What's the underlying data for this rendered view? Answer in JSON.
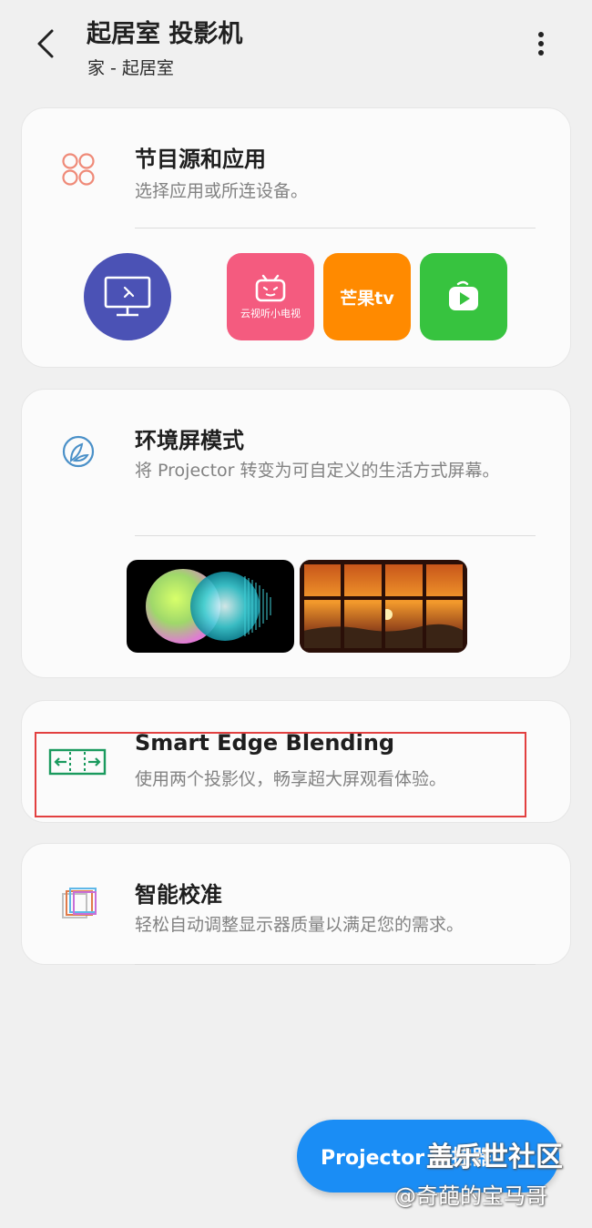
{
  "header": {
    "title": "起居室 投影机",
    "subtitle": "家 - 起居室",
    "back_icon": "chevron-left-icon",
    "more_icon": "more-vertical-icon"
  },
  "cards": {
    "sources": {
      "title": "节目源和应用",
      "description": "选择应用或所连设备。",
      "icon": "apps-grid-icon",
      "source_icon": "screen-mirror-icon",
      "apps": [
        {
          "label": "云视听小电视",
          "color": "#f45b7f",
          "icon": "bilibili-tv-icon"
        },
        {
          "label": "芒果tv",
          "color": "#ff8a00",
          "icon": "mango-tv-icon"
        },
        {
          "label": "",
          "color": "#37c33f",
          "icon": "video-play-icon"
        }
      ]
    },
    "ambient": {
      "title": "环境屏模式",
      "description": "将 Projector 转变为可自定义的生活方式屏幕。",
      "icon": "ambient-leaf-icon",
      "thumbnails": [
        "gradient-orbs-thumb",
        "sunset-window-thumb"
      ]
    },
    "edge": {
      "title": "Smart Edge Blending",
      "description": "使用两个投影仪，畅享超大屏观看体验。",
      "icon": "edge-blend-icon"
    },
    "calibration": {
      "title": "智能校准",
      "description": "轻松自动调整显示器质量以满足您的需求。",
      "icon": "calibration-frames-icon"
    }
  },
  "fab": {
    "label": "Projector 遥控器"
  },
  "watermark": {
    "line1": "盖乐世社区",
    "line2": "@奇葩的宝马哥"
  },
  "colors": {
    "accent": "#1a8df5",
    "source_circle": "#4b52b5",
    "highlight_box": "#e24040",
    "edge_icon": "#1a9a5e"
  }
}
